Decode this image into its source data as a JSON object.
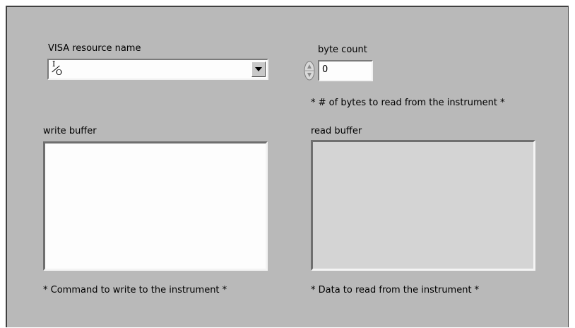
{
  "visa": {
    "label": "VISA resource name",
    "io_icon_top": "I",
    "io_icon_bottom": "O",
    "value": ""
  },
  "byte_count": {
    "label": "byte count",
    "value": "0",
    "note": "* # of bytes to read from the instrument *"
  },
  "write_buffer": {
    "label": "write buffer",
    "value": "",
    "note": "* Command to write to the instrument *"
  },
  "read_buffer": {
    "label": "read buffer",
    "value": "",
    "note": "* Data to read from the instrument *"
  },
  "colors": {
    "panel": "#b9b9b9",
    "field": "#fdfdfd",
    "indicator": "#d4d4d4"
  }
}
